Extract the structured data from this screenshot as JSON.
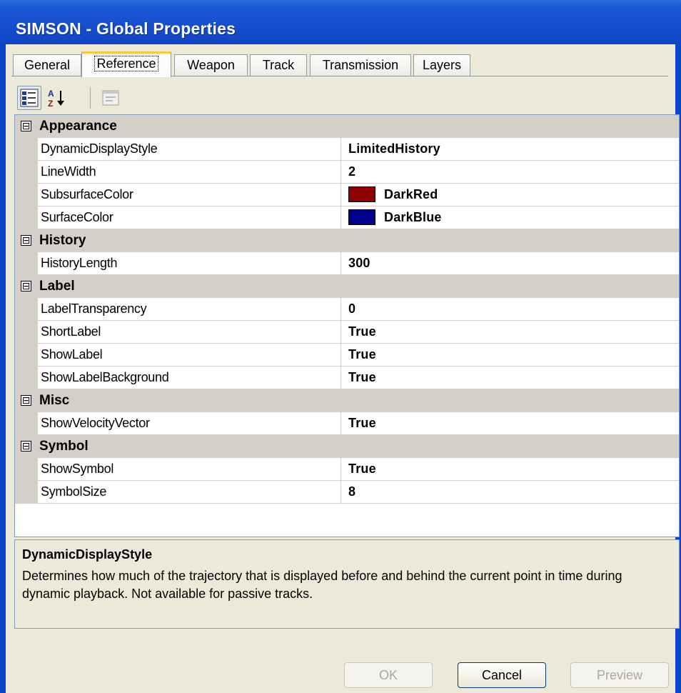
{
  "window": {
    "title": "SIMSON - Global Properties"
  },
  "tabs": [
    {
      "label": "General"
    },
    {
      "label": "Reference",
      "active": true
    },
    {
      "label": "Weapon"
    },
    {
      "label": "Track"
    },
    {
      "label": "Transmission"
    },
    {
      "label": "Layers"
    }
  ],
  "toolbar": {
    "buttons": [
      "categorized-icon",
      "alphabetical-sort-icon",
      "property-pages-icon"
    ]
  },
  "grid": {
    "categories": [
      {
        "label": "Appearance",
        "expander": "⊟",
        "properties": [
          {
            "name": "DynamicDisplayStyle",
            "value": "LimitedHistory"
          },
          {
            "name": "LineWidth",
            "value": "2"
          },
          {
            "name": "SubsurfaceColor",
            "value": "DarkRed",
            "color": "#8b0000"
          },
          {
            "name": "SurfaceColor",
            "value": "DarkBlue",
            "color": "#00008b"
          }
        ]
      },
      {
        "label": "History",
        "expander": "⊟",
        "properties": [
          {
            "name": "HistoryLength",
            "value": "300"
          }
        ]
      },
      {
        "label": "Label",
        "expander": "⊟",
        "properties": [
          {
            "name": "LabelTransparency",
            "value": "0"
          },
          {
            "name": "ShortLabel",
            "value": "True"
          },
          {
            "name": "ShowLabel",
            "value": "True"
          },
          {
            "name": "ShowLabelBackground",
            "value": "True"
          }
        ]
      },
      {
        "label": "Misc",
        "expander": "⊟",
        "properties": [
          {
            "name": "ShowVelocityVector",
            "value": "True"
          }
        ]
      },
      {
        "label": "Symbol",
        "expander": "⊟",
        "properties": [
          {
            "name": "ShowSymbol",
            "value": "True"
          },
          {
            "name": "SymbolSize",
            "value": "8"
          }
        ]
      }
    ]
  },
  "description": {
    "title": "DynamicDisplayStyle",
    "text": "Determines how much of the trajectory that is displayed before and behind the current point in time during dynamic playback. Not available for passive tracks."
  },
  "buttons": {
    "ok": "OK",
    "cancel": "Cancel",
    "preview": "Preview"
  },
  "colors": {
    "title_bar": "#1048c8",
    "category_band": "#d4d0c8",
    "active_tab_highlight": "#ffc83c"
  }
}
